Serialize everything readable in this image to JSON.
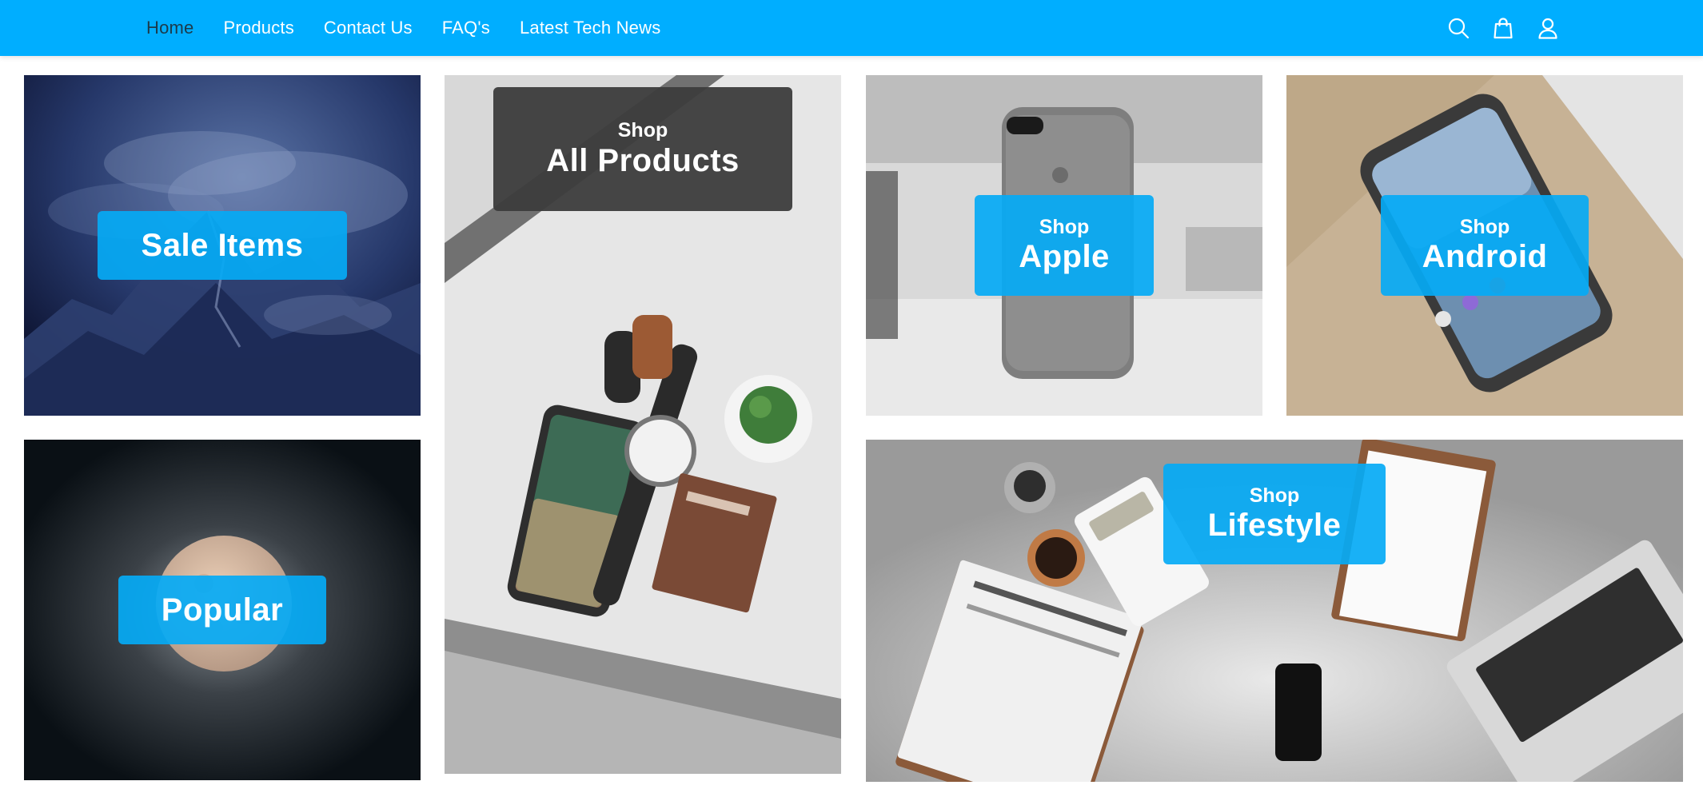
{
  "nav": {
    "items": [
      {
        "label": "Home",
        "active": true
      },
      {
        "label": "Products"
      },
      {
        "label": "Contact Us"
      },
      {
        "label": "FAQ's"
      },
      {
        "label": "Latest Tech News"
      }
    ],
    "icons": [
      "search-icon",
      "shopping-bag-icon",
      "user-icon"
    ]
  },
  "colors": {
    "header": "#00aeff",
    "label_blue": "#05aaf5",
    "label_dark": "#3c3c3c"
  },
  "tiles": {
    "sale": {
      "title": "Sale Items"
    },
    "popular": {
      "title": "Popular"
    },
    "all": {
      "prefix": "Shop",
      "title": "All Products"
    },
    "apple": {
      "prefix": "Shop",
      "title": "Apple"
    },
    "android": {
      "prefix": "Shop",
      "title": "Android"
    },
    "life": {
      "prefix": "Shop",
      "title": "Lifestyle"
    }
  }
}
